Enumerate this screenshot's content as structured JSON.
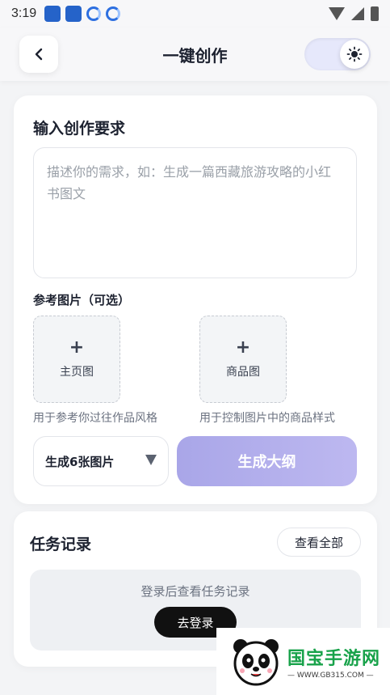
{
  "status_bar": {
    "time": "3:19",
    "left_icons": [
      "app-icon",
      "app-icon",
      "sync-icon",
      "sync-icon"
    ],
    "right_icons": [
      "wifi-icon",
      "signal-icon",
      "battery-icon"
    ]
  },
  "header": {
    "title": "一键创作",
    "back_icon": "chevron-left-icon",
    "theme_icon": "sun-icon"
  },
  "create": {
    "section_title": "输入创作要求",
    "prompt_placeholder": "描述你的需求，如：生成一篇西藏旅游攻略的小红书图文",
    "ref_title": "参考图片（可选）",
    "uploads": [
      {
        "label": "主页图",
        "hint": "用于参考你过往作品风格"
      },
      {
        "label": "商品图",
        "hint": "用于控制图片中的商品样式"
      }
    ],
    "plus_glyph": "+",
    "image_count": "生成6张图片",
    "generate_label": "生成大纲"
  },
  "tasks": {
    "title": "任务记录",
    "view_all_label": "查看全部",
    "empty_text": "登录后查看任务记录",
    "login_label": "去登录"
  },
  "watermark": {
    "title": "国宝手游网",
    "url": "— WWW.GB315.COM —"
  },
  "colors": {
    "accent_button": "#a9a6e8",
    "toggle_track": "#e6e8fb",
    "watermark_green": "#18a24a"
  }
}
